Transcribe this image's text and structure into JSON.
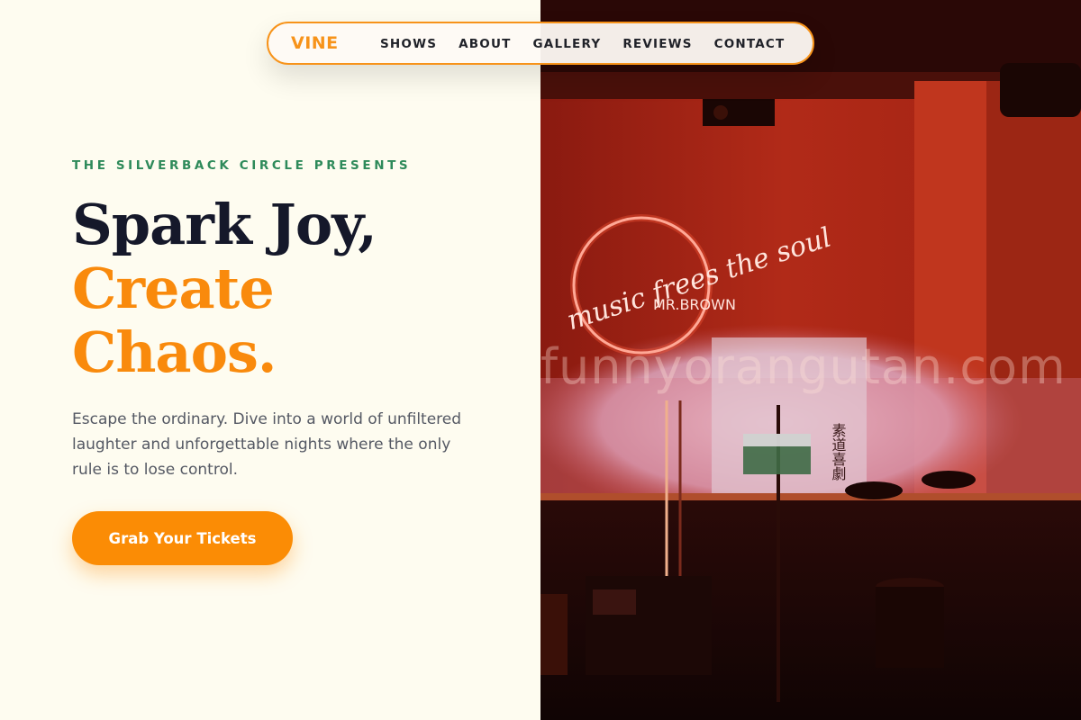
{
  "nav": {
    "brand": "VINE",
    "links": [
      "SHOWS",
      "ABOUT",
      "GALLERY",
      "REVIEWS",
      "CONTACT"
    ]
  },
  "hero": {
    "eyebrow": "THE SILVERBACK CIRCLE PRESENTS",
    "headline_line1": "Spark Joy,",
    "headline_line2": "Create",
    "headline_line3": "Chaos.",
    "description": "Escape the ordinary. Dive into a world of unfiltered laughter and unforgettable nights where the only rule is to lose control.",
    "cta_label": "Grab Your Tickets"
  },
  "photo": {
    "neon_text": "music frees the soul",
    "neon_subtext": "MR.BROWN",
    "poster_text": "素道喜劇",
    "watermark": "funnyorangutan.com"
  },
  "colors": {
    "accent": "#f98a0c",
    "eyebrow_green": "#2e8a5a",
    "dark_text": "#15182a",
    "background": "#fefcf0"
  }
}
